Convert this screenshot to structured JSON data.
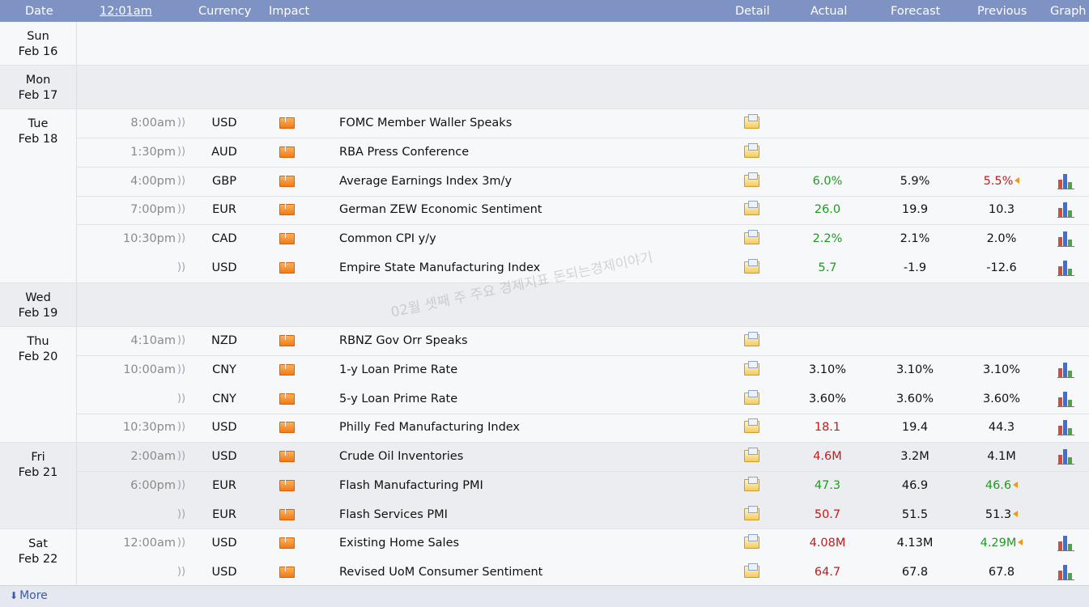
{
  "header": {
    "date_label": "Date",
    "time_label": "12:01am",
    "currency_label": "Currency",
    "impact_label": "Impact",
    "detail_label": "Detail",
    "actual_label": "Actual",
    "forecast_label": "Forecast",
    "previous_label": "Previous",
    "graph_label": "Graph"
  },
  "colors": {
    "header_bg": "#7e92c3",
    "better": "#1f9a1f",
    "worse": "#c21b1b",
    "impact_medium": "#f0861f"
  },
  "watermark": "02월 셋째 주 주요 경제지표 돈되는경제이야기",
  "days": [
    {
      "weekday": "Sun",
      "date": "Feb 16",
      "events": []
    },
    {
      "weekday": "Mon",
      "date": "Feb 17",
      "events": []
    },
    {
      "weekday": "Tue",
      "date": "Feb 18",
      "events": [
        {
          "time": "8:00am",
          "currency": "USD",
          "impact": "medium",
          "title": "FOMC Member Waller Speaks",
          "actual": "",
          "actual_status": "",
          "forecast": "",
          "previous": "",
          "previous_status": "",
          "revised": false,
          "graph": false
        },
        {
          "time": "1:30pm",
          "currency": "AUD",
          "impact": "medium",
          "title": "RBA Press Conference",
          "actual": "",
          "actual_status": "",
          "forecast": "",
          "previous": "",
          "previous_status": "",
          "revised": false,
          "graph": false
        },
        {
          "time": "4:00pm",
          "currency": "GBP",
          "impact": "medium",
          "title": "Average Earnings Index 3m/y",
          "actual": "6.0%",
          "actual_status": "better",
          "forecast": "5.9%",
          "previous": "5.5%",
          "previous_status": "worse",
          "revised": true,
          "graph": true
        },
        {
          "time": "7:00pm",
          "currency": "EUR",
          "impact": "medium",
          "title": "German ZEW Economic Sentiment",
          "actual": "26.0",
          "actual_status": "better",
          "forecast": "19.9",
          "previous": "10.3",
          "previous_status": "",
          "revised": false,
          "graph": true
        },
        {
          "time": "10:30pm",
          "currency": "CAD",
          "impact": "medium",
          "title": "Common CPI y/y",
          "actual": "2.2%",
          "actual_status": "better",
          "forecast": "2.1%",
          "previous": "2.0%",
          "previous_status": "",
          "revised": false,
          "graph": true
        },
        {
          "time": "",
          "currency": "USD",
          "impact": "medium",
          "title": "Empire State Manufacturing Index",
          "actual": "5.7",
          "actual_status": "better",
          "forecast": "-1.9",
          "previous": "-12.6",
          "previous_status": "",
          "revised": false,
          "graph": true
        }
      ]
    },
    {
      "weekday": "Wed",
      "date": "Feb 19",
      "events": []
    },
    {
      "weekday": "Thu",
      "date": "Feb 20",
      "events": [
        {
          "time": "4:10am",
          "currency": "NZD",
          "impact": "medium",
          "title": "RBNZ Gov Orr Speaks",
          "actual": "",
          "actual_status": "",
          "forecast": "",
          "previous": "",
          "previous_status": "",
          "revised": false,
          "graph": false
        },
        {
          "time": "10:00am",
          "currency": "CNY",
          "impact": "medium",
          "title": "1-y Loan Prime Rate",
          "actual": "3.10%",
          "actual_status": "",
          "forecast": "3.10%",
          "previous": "3.10%",
          "previous_status": "",
          "revised": false,
          "graph": true
        },
        {
          "time": "",
          "currency": "CNY",
          "impact": "medium",
          "title": "5-y Loan Prime Rate",
          "actual": "3.60%",
          "actual_status": "",
          "forecast": "3.60%",
          "previous": "3.60%",
          "previous_status": "",
          "revised": false,
          "graph": true
        },
        {
          "time": "10:30pm",
          "currency": "USD",
          "impact": "medium",
          "title": "Philly Fed Manufacturing Index",
          "actual": "18.1",
          "actual_status": "worse",
          "forecast": "19.4",
          "previous": "44.3",
          "previous_status": "",
          "revised": false,
          "graph": true
        }
      ]
    },
    {
      "weekday": "Fri",
      "date": "Feb 21",
      "events": [
        {
          "time": "2:00am",
          "currency": "USD",
          "impact": "medium",
          "title": "Crude Oil Inventories",
          "actual": "4.6M",
          "actual_status": "worse",
          "forecast": "3.2M",
          "previous": "4.1M",
          "previous_status": "",
          "revised": false,
          "graph": true
        },
        {
          "time": "6:00pm",
          "currency": "EUR",
          "impact": "medium",
          "title": "Flash Manufacturing PMI",
          "actual": "47.3",
          "actual_status": "better",
          "forecast": "46.9",
          "previous": "46.6",
          "previous_status": "better",
          "revised": true,
          "graph": false
        },
        {
          "time": "",
          "currency": "EUR",
          "impact": "medium",
          "title": "Flash Services PMI",
          "actual": "50.7",
          "actual_status": "worse",
          "forecast": "51.5",
          "previous": "51.3",
          "previous_status": "",
          "revised": true,
          "graph": false
        }
      ]
    },
    {
      "weekday": "Sat",
      "date": "Feb 22",
      "events": [
        {
          "time": "12:00am",
          "currency": "USD",
          "impact": "medium",
          "title": "Existing Home Sales",
          "actual": "4.08M",
          "actual_status": "worse",
          "forecast": "4.13M",
          "previous": "4.29M",
          "previous_status": "better",
          "revised": true,
          "graph": true
        },
        {
          "time": "",
          "currency": "USD",
          "impact": "medium",
          "title": "Revised UoM Consumer Sentiment",
          "actual": "64.7",
          "actual_status": "worse",
          "forecast": "67.8",
          "previous": "67.8",
          "previous_status": "",
          "revised": false,
          "graph": true
        }
      ]
    }
  ],
  "footer": {
    "more_label": "More"
  }
}
